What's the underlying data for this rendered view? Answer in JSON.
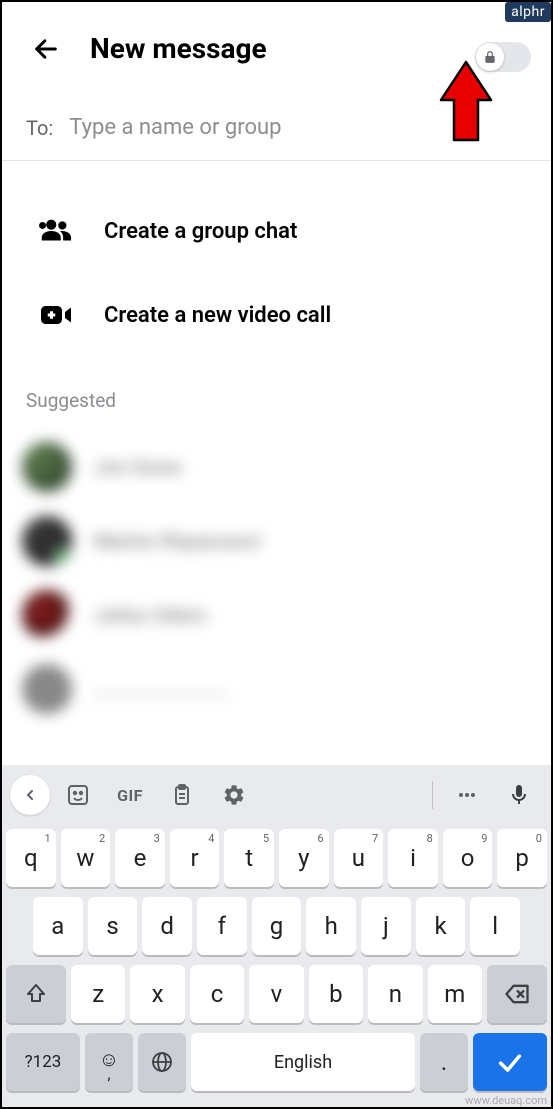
{
  "badge": "alphr",
  "watermark": "www.deuaq.com",
  "header": {
    "title": "New message"
  },
  "to": {
    "label": "To:",
    "placeholder": "Type a name or group"
  },
  "options": {
    "group_chat": "Create a group chat",
    "video_call": "Create a new video call"
  },
  "suggested": {
    "header": "Suggested",
    "contacts": [
      {
        "name": "Jon Snow"
      },
      {
        "name": "Marlon Riquecaoci"
      },
      {
        "name": "Julius Odero"
      }
    ]
  },
  "keyboard": {
    "gif": "GIF",
    "row1": [
      {
        "k": "q",
        "s": "1"
      },
      {
        "k": "w",
        "s": "2"
      },
      {
        "k": "e",
        "s": "3"
      },
      {
        "k": "r",
        "s": "4"
      },
      {
        "k": "t",
        "s": "5"
      },
      {
        "k": "y",
        "s": "6"
      },
      {
        "k": "u",
        "s": "7"
      },
      {
        "k": "i",
        "s": "8"
      },
      {
        "k": "o",
        "s": "9"
      },
      {
        "k": "p",
        "s": "0"
      }
    ],
    "row2": [
      "a",
      "s",
      "d",
      "f",
      "g",
      "h",
      "j",
      "k",
      "l"
    ],
    "row3": [
      "z",
      "x",
      "c",
      "v",
      "b",
      "n",
      "m"
    ],
    "symbols": "?123",
    "comma": ",",
    "space": "English",
    "period": "."
  }
}
